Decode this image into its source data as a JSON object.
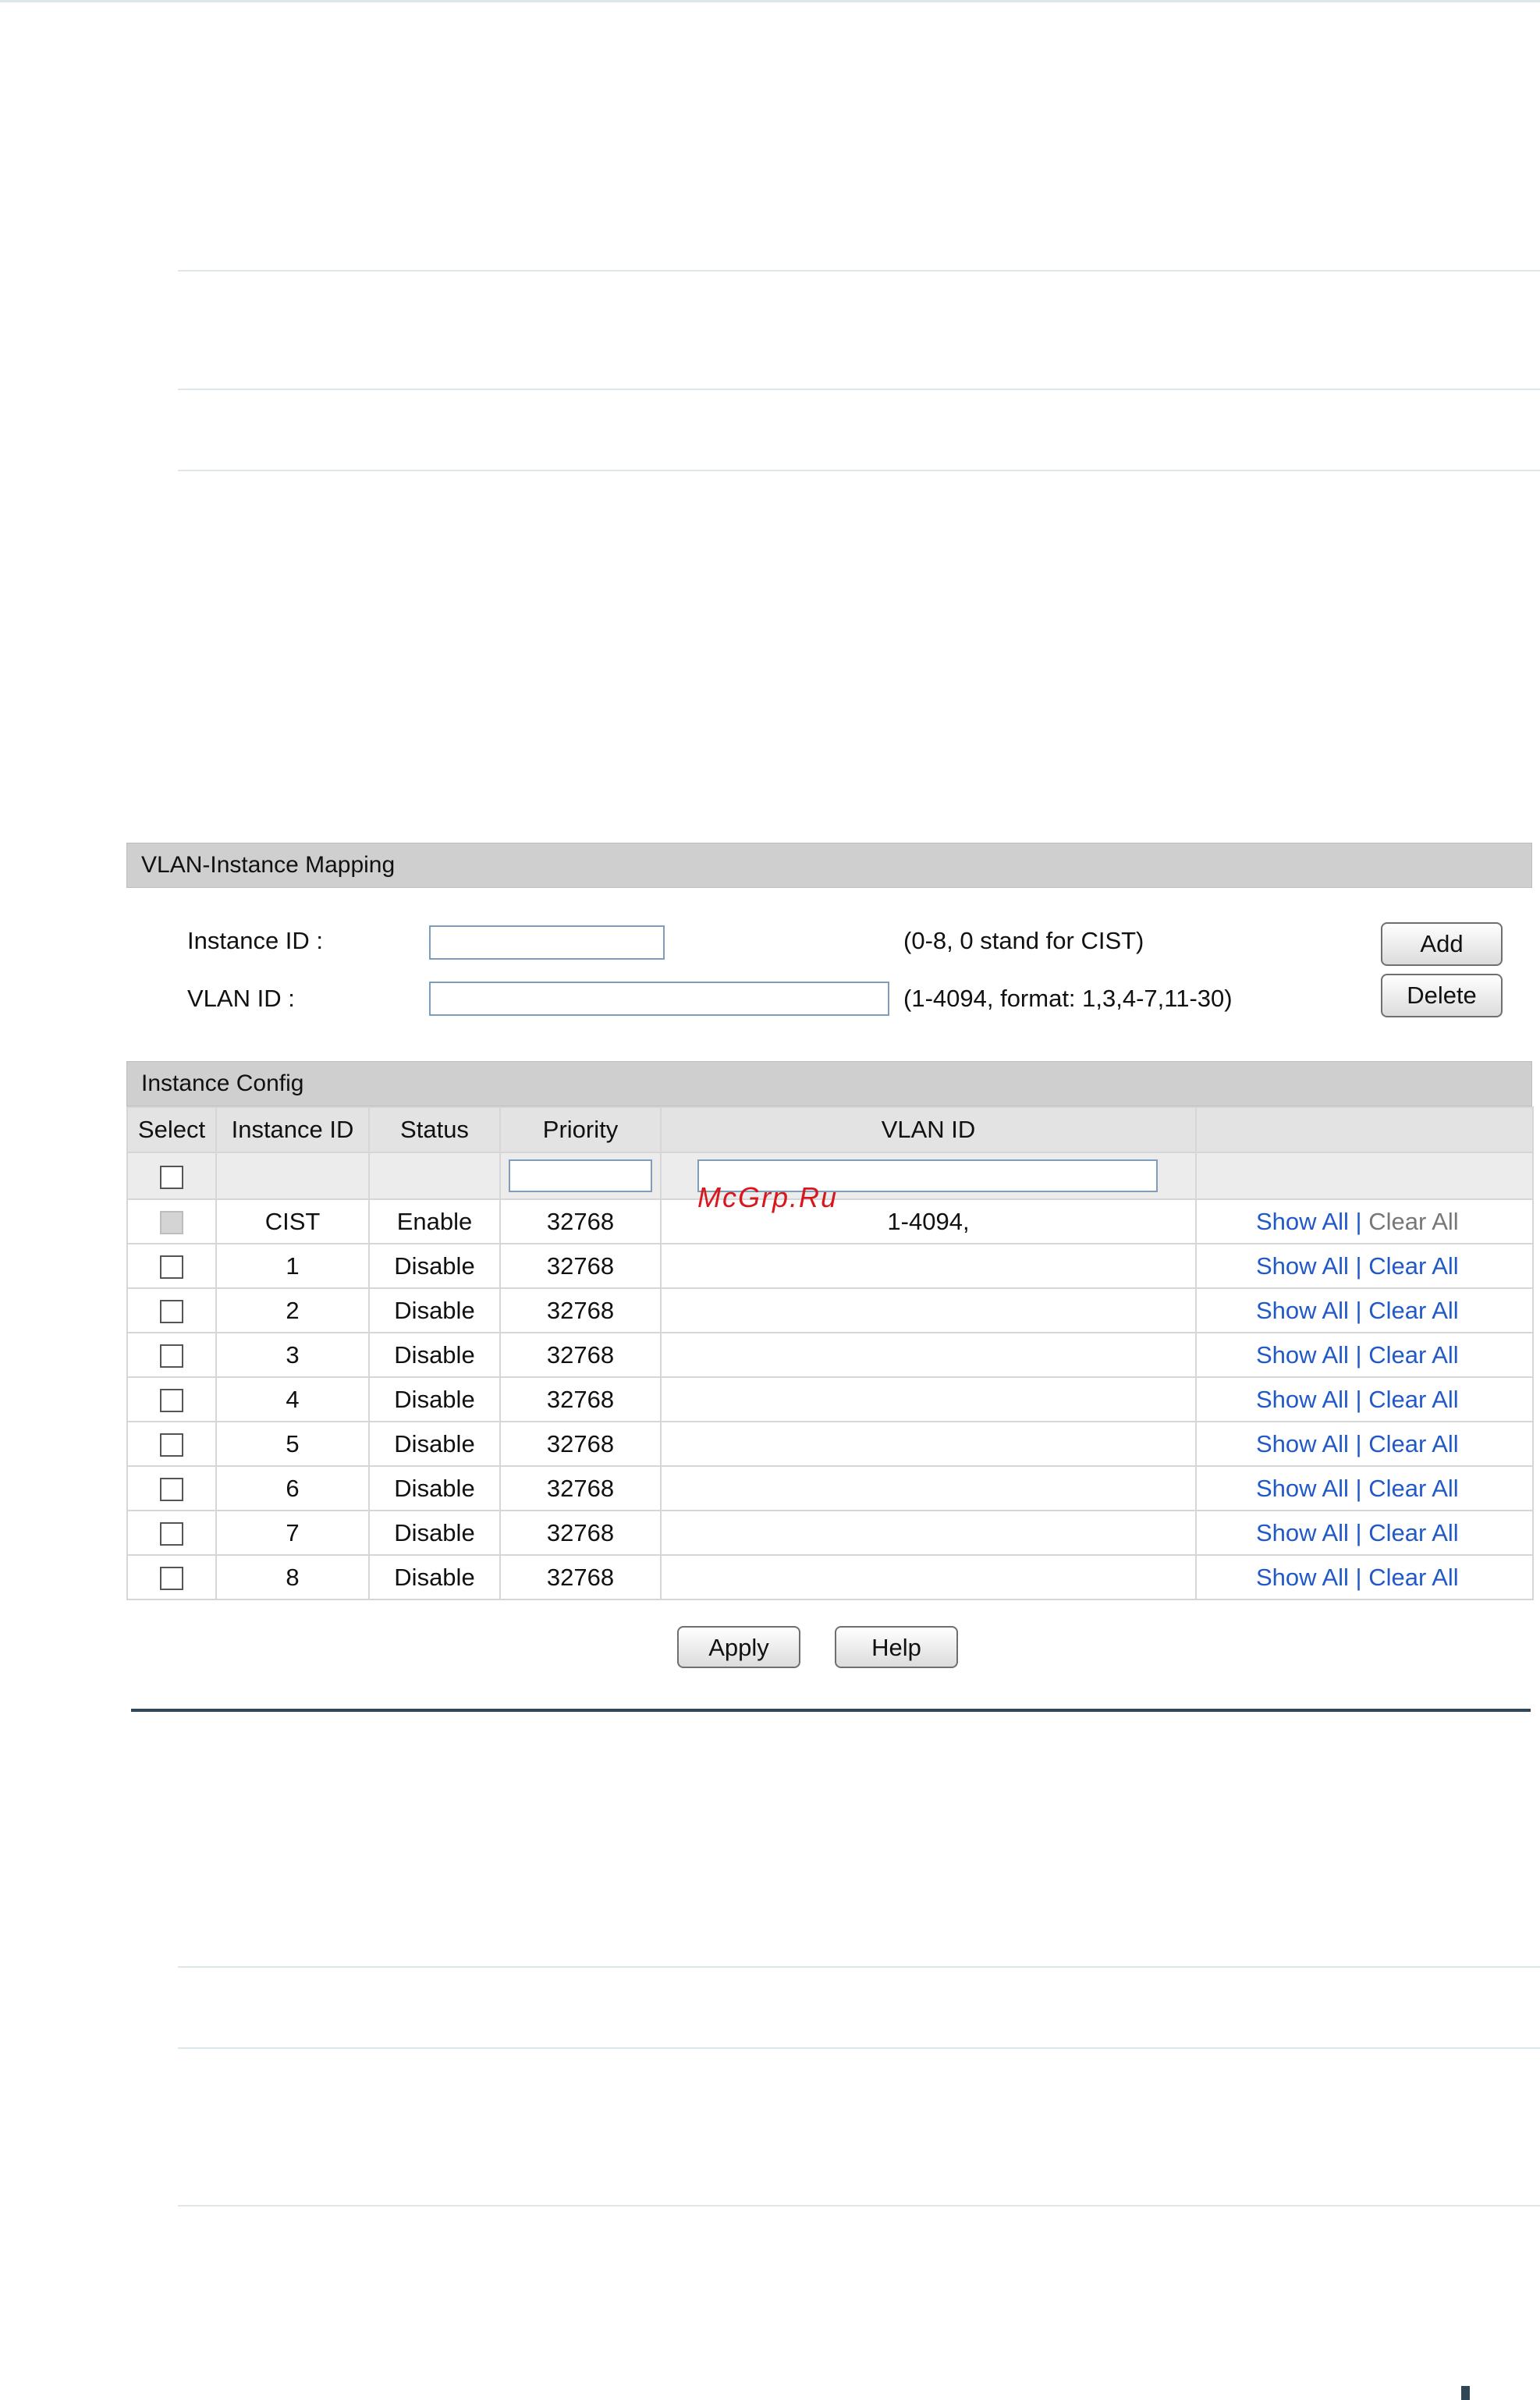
{
  "mapping": {
    "title": "VLAN-Instance Mapping",
    "instance_label": "Instance ID :",
    "instance_hint": "(0-8, 0 stand for CIST)",
    "vlan_label": "VLAN ID :",
    "vlan_hint": "(1-4094, format: 1,3,4-7,11-30)",
    "add_label": "Add",
    "delete_label": "Delete"
  },
  "config": {
    "title": "Instance Config",
    "columns": [
      "Select",
      "Instance ID",
      "Status",
      "Priority",
      "VLAN ID",
      ""
    ],
    "rows": [
      {
        "id": "CIST",
        "status": "Enable",
        "priority": "32768",
        "vlan": "1-4094,",
        "show": "Show All",
        "sep": "|",
        "clear": "Clear All"
      },
      {
        "id": "1",
        "status": "Disable",
        "priority": "32768",
        "vlan": "",
        "show": "Show All",
        "sep": "|",
        "clear": "Clear All"
      },
      {
        "id": "2",
        "status": "Disable",
        "priority": "32768",
        "vlan": "",
        "show": "Show All",
        "sep": "|",
        "clear": "Clear All"
      },
      {
        "id": "3",
        "status": "Disable",
        "priority": "32768",
        "vlan": "",
        "show": "Show All",
        "sep": "|",
        "clear": "Clear All"
      },
      {
        "id": "4",
        "status": "Disable",
        "priority": "32768",
        "vlan": "",
        "show": "Show All",
        "sep": "|",
        "clear": "Clear All"
      },
      {
        "id": "5",
        "status": "Disable",
        "priority": "32768",
        "vlan": "",
        "show": "Show All",
        "sep": "|",
        "clear": "Clear All"
      },
      {
        "id": "6",
        "status": "Disable",
        "priority": "32768",
        "vlan": "",
        "show": "Show All",
        "sep": "|",
        "clear": "Clear All"
      },
      {
        "id": "7",
        "status": "Disable",
        "priority": "32768",
        "vlan": "",
        "show": "Show All",
        "sep": "|",
        "clear": "Clear All"
      },
      {
        "id": "8",
        "status": "Disable",
        "priority": "32768",
        "vlan": "",
        "show": "Show All",
        "sep": "|",
        "clear": "Clear All"
      }
    ]
  },
  "actions": {
    "apply_label": "Apply",
    "help_label": "Help"
  },
  "watermark": "McGrp.Ru",
  "colors": {
    "link": "#2259c8",
    "header_bg": "#cfcfcf",
    "divider": "#2f4656"
  }
}
